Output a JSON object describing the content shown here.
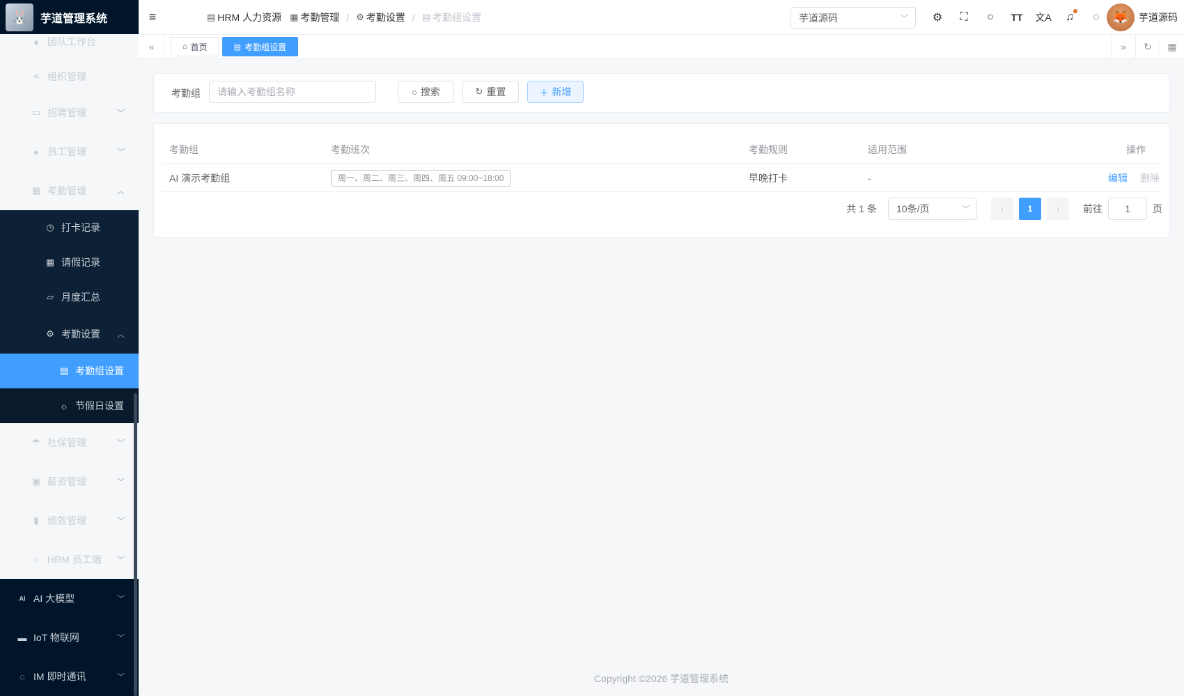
{
  "app": {
    "title": "芋道管理系统"
  },
  "sidebar": {
    "items": [
      {
        "label": "团队工作台",
        "icon": "user-icon"
      },
      {
        "label": "组织管理",
        "icon": "share-icon"
      },
      {
        "label": "招聘管理",
        "icon": "briefcase-icon"
      },
      {
        "label": "员工管理",
        "icon": "user-icon"
      },
      {
        "label": "考勤管理",
        "icon": "calendar-icon"
      },
      {
        "label": "打卡记录",
        "icon": "stopwatch-icon"
      },
      {
        "label": "请假记录",
        "icon": "calendar-icon"
      },
      {
        "label": "月度汇总",
        "icon": "chart-icon"
      },
      {
        "label": "考勤设置",
        "icon": "gear-icon"
      },
      {
        "label": "考勤组设置",
        "icon": "building-icon"
      },
      {
        "label": "节假日设置",
        "icon": "sun-icon"
      },
      {
        "label": "社保管理",
        "icon": "umbrella-icon"
      },
      {
        "label": "薪资管理",
        "icon": "wallet-icon"
      },
      {
        "label": "绩效管理",
        "icon": "bar-chart-icon"
      },
      {
        "label": "HRM 员工端",
        "icon": "user-icon"
      },
      {
        "label": "AI 大模型",
        "icon": "ai-icon"
      },
      {
        "label": "IoT 物联网",
        "icon": "car-icon"
      },
      {
        "label": "IM 即时通讯",
        "icon": "chat-icon"
      }
    ]
  },
  "header": {
    "breadcrumb": [
      "HRM 人力资源",
      "考勤管理",
      "考勤设置",
      "考勤组设置"
    ],
    "tenant": "芋道源码",
    "username": "芋道源码"
  },
  "tags": {
    "home": "首页",
    "current": "考勤组设置"
  },
  "search": {
    "label": "考勤组",
    "placeholder": "请输入考勤组名称",
    "search_btn": "搜索",
    "reset_btn": "重置",
    "add_btn": "新增"
  },
  "table": {
    "columns": [
      "考勤组",
      "考勤班次",
      "考勤规则",
      "适用范围",
      "操作"
    ],
    "rows": [
      {
        "name": "AI 演示考勤组",
        "shift": "周一、周二、周三、周四、周五 09:00~18:00",
        "rule": "早晚打卡",
        "scope": "-",
        "edit": "编辑",
        "delete": "删除"
      }
    ]
  },
  "pagination": {
    "total": "共 1 条",
    "page_size": "10条/页",
    "current_page": "1",
    "goto_label": "前往",
    "goto_value": "1",
    "page_suffix": "页"
  },
  "footer": {
    "copyright": "Copyright ©2026 芋道管理系统"
  },
  "colors": {
    "primary": "#409eff",
    "sidebar_bg": "#001529"
  }
}
